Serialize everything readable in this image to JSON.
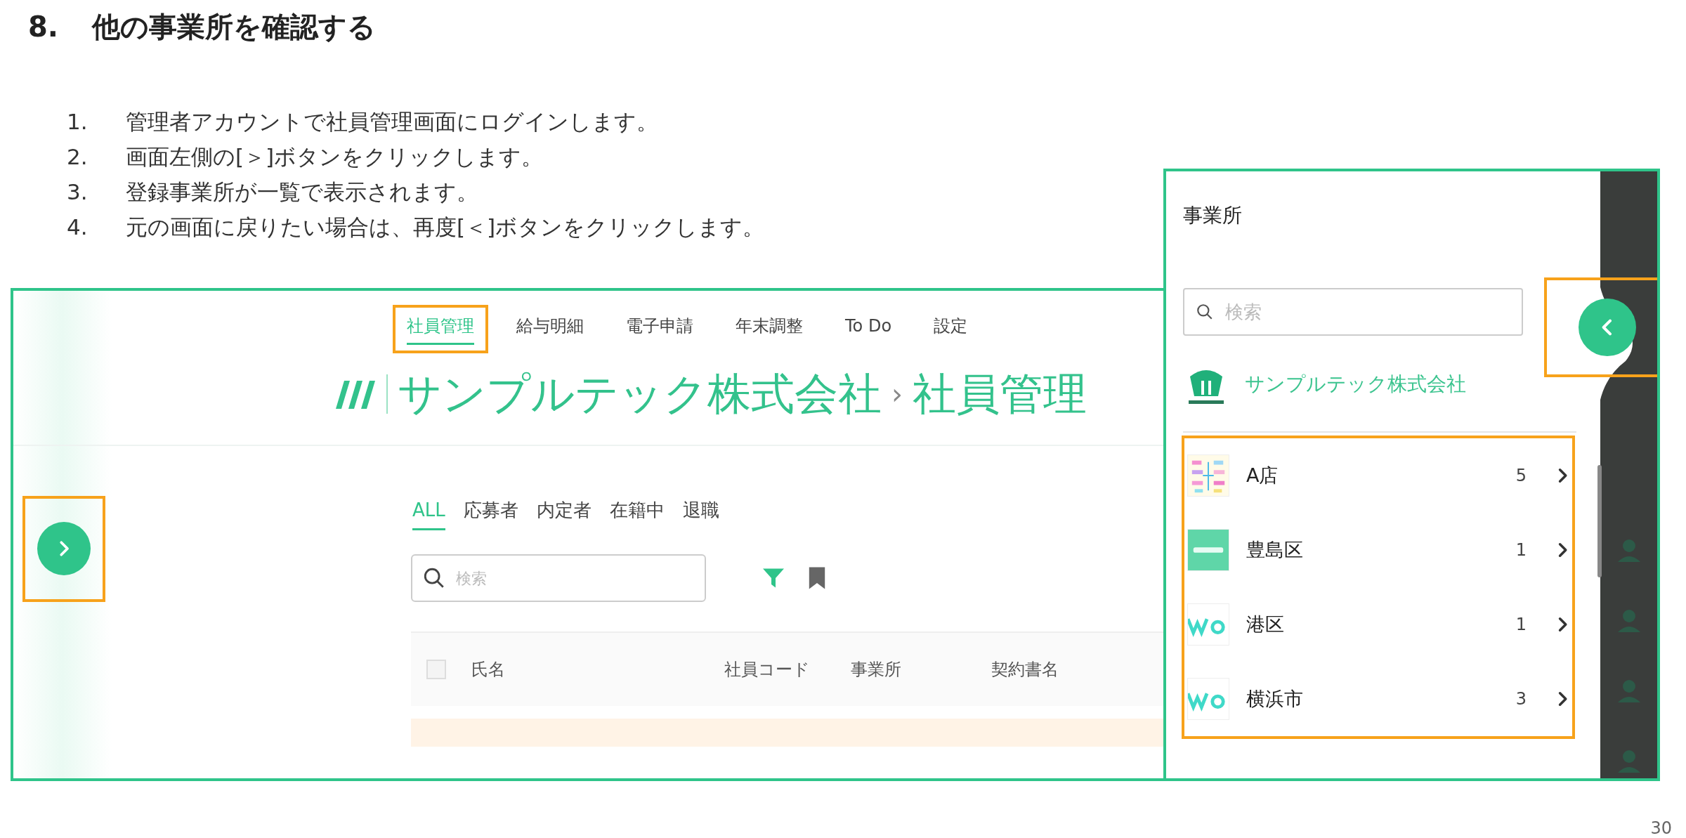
{
  "heading": {
    "number": "8.",
    "title": "他の事業所を確認する"
  },
  "steps": [
    {
      "number": "1.",
      "text": "管理者アカウントで社員管理画面にログインします。"
    },
    {
      "number": "2.",
      "text": "画面左側の[＞]ボタンをクリックします。"
    },
    {
      "number": "3.",
      "text": "登録事業所が一覧で表示されます。"
    },
    {
      "number": "4.",
      "text": "元の画面に戻りたい場合は、再度[＜]ボタンをクリックします。"
    }
  ],
  "employee_screen": {
    "nav_tabs": [
      {
        "label": "社員管理",
        "selected": true,
        "highlighted": true
      },
      {
        "label": "給与明細",
        "selected": false,
        "highlighted": false
      },
      {
        "label": "電子申請",
        "selected": false,
        "highlighted": false
      },
      {
        "label": "年末調整",
        "selected": false,
        "highlighted": false
      },
      {
        "label": "To Do",
        "selected": false,
        "highlighted": false
      },
      {
        "label": "設定",
        "selected": false,
        "highlighted": false
      }
    ],
    "breadcrumb": {
      "company": "サンプルテック株式会社",
      "separator": "›",
      "page": "社員管理"
    },
    "status_tabs": [
      {
        "label": "ALL",
        "selected": true
      },
      {
        "label": "応募者",
        "selected": false
      },
      {
        "label": "内定者",
        "selected": false
      },
      {
        "label": "在籍中",
        "selected": false
      },
      {
        "label": "退職",
        "selected": false
      }
    ],
    "search": {
      "placeholder": "検索"
    },
    "table": {
      "select_all_checked": false,
      "columns": [
        "氏名",
        "社員コード",
        "事業所",
        "契約書名"
      ]
    },
    "expand_button": {
      "highlighted": true
    }
  },
  "office_panel": {
    "title": "事業所",
    "search": {
      "placeholder": "検索"
    },
    "company": {
      "name": "サンプルテック株式会社"
    },
    "offices_highlighted": true,
    "offices": [
      {
        "name": "A店",
        "count": "5",
        "kind": "mosaic"
      },
      {
        "name": "豊島区",
        "count": "1",
        "kind": "logo"
      },
      {
        "name": "港区",
        "count": "1",
        "kind": "banner"
      },
      {
        "name": "横浜市",
        "count": "3",
        "kind": "banner"
      }
    ],
    "collapse_button": {
      "highlighted": true
    }
  },
  "page_number": "30"
}
